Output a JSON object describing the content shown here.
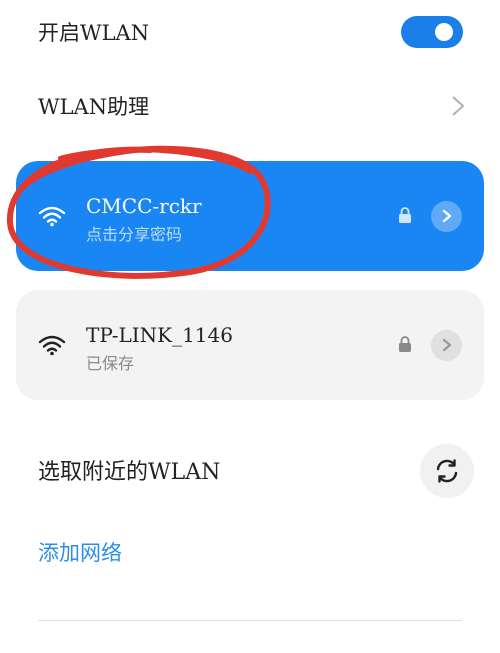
{
  "wlan": {
    "label": "开启WLAN",
    "enabled": true
  },
  "assistant": {
    "label": "WLAN助理"
  },
  "networks": [
    {
      "ssid": "CMCC-rckr",
      "subtitle": "点击分享密码",
      "state": "connected",
      "secured": true
    },
    {
      "ssid": "TP-LINK_1146",
      "subtitle": "已保存",
      "state": "saved",
      "secured": true
    }
  ],
  "nearby": {
    "label": "选取附近的WLAN"
  },
  "add_network": {
    "label": "添加网络"
  },
  "colors": {
    "accent": "#1a86f4",
    "annotation": "#e0392f"
  },
  "icons": [
    "chevron-right-icon",
    "wifi-icon",
    "lock-icon",
    "arrow-right-icon",
    "refresh-icon"
  ]
}
